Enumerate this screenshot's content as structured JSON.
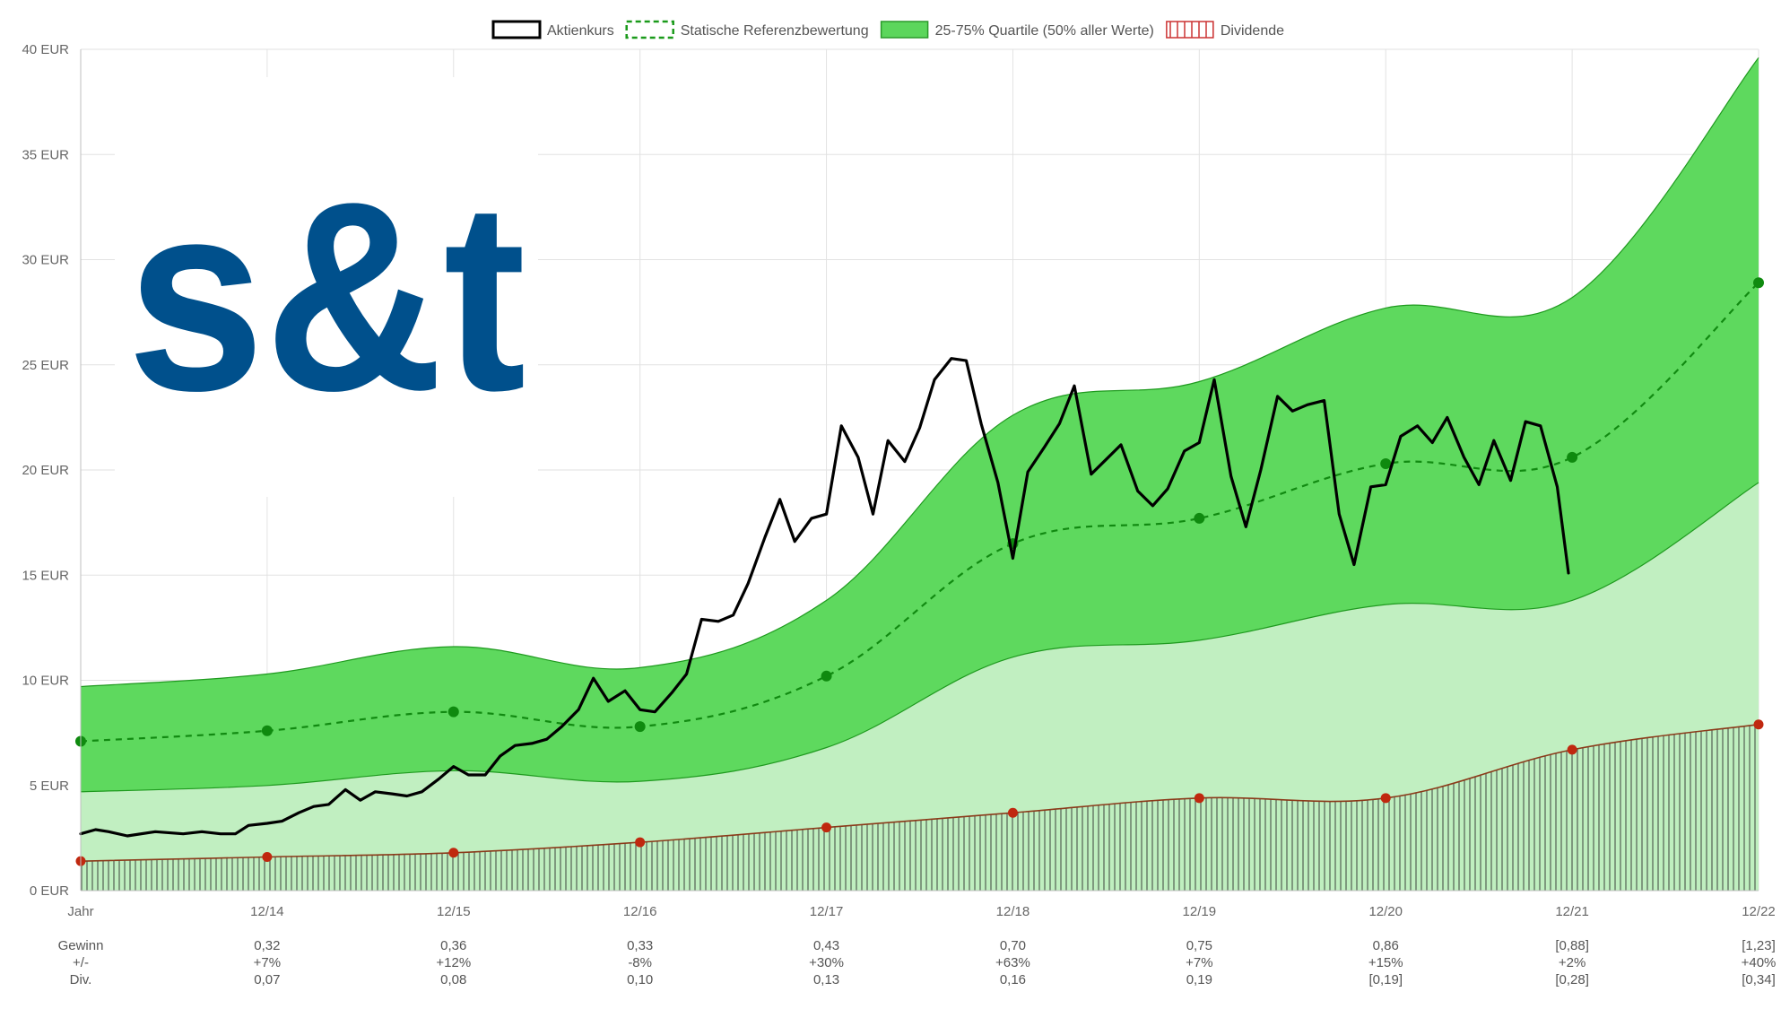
{
  "chart_data": {
    "type": "line",
    "legend": [
      {
        "label": "Aktienkurs",
        "style": "solid",
        "color": "#000000"
      },
      {
        "label": "Statische Referenzbewertung",
        "style": "dashed",
        "color": "#1a9a1a"
      },
      {
        "label": "25-75% Quartile (50% aller Werte)",
        "style": "area",
        "color": "#5cd65c"
      },
      {
        "label": "Dividende",
        "style": "hatched",
        "color": "#cc3333"
      }
    ],
    "legend_position": "top-center",
    "grid": true,
    "x_ticks": [
      "Jahr",
      "12/14",
      "12/15",
      "12/16",
      "12/17",
      "12/18",
      "12/19",
      "12/20",
      "12/21",
      "12/22"
    ],
    "y_ticks": [
      "0 EUR",
      "5 EUR",
      "10 EUR",
      "15 EUR",
      "20 EUR",
      "25 EUR",
      "30 EUR",
      "35 EUR",
      "40 EUR"
    ],
    "ylim": [
      0,
      40
    ],
    "x_index_range": [
      0,
      9
    ],
    "referenzbewertung": [
      7.1,
      7.6,
      8.5,
      7.8,
      10.2,
      16.5,
      17.7,
      20.3,
      20.6,
      28.9
    ],
    "quartile_upper": [
      9.7,
      10.3,
      11.6,
      10.6,
      13.8,
      22.6,
      24.2,
      27.7,
      28.2,
      39.6
    ],
    "quartile_lower": [
      4.7,
      5.0,
      5.7,
      5.2,
      6.8,
      11.1,
      11.9,
      13.6,
      13.8,
      19.4
    ],
    "dividende": [
      1.4,
      1.6,
      1.8,
      2.3,
      3.0,
      3.7,
      4.4,
      4.4,
      6.7,
      7.9
    ],
    "aktienkurs": [
      [
        0.0,
        2.7
      ],
      [
        0.08,
        2.9
      ],
      [
        0.15,
        2.8
      ],
      [
        0.25,
        2.6
      ],
      [
        0.4,
        2.8
      ],
      [
        0.55,
        2.7
      ],
      [
        0.65,
        2.8
      ],
      [
        0.75,
        2.7
      ],
      [
        0.83,
        2.7
      ],
      [
        0.9,
        3.1
      ],
      [
        1.0,
        3.2
      ],
      [
        1.08,
        3.3
      ],
      [
        1.17,
        3.7
      ],
      [
        1.25,
        4.0
      ],
      [
        1.33,
        4.1
      ],
      [
        1.42,
        4.8
      ],
      [
        1.5,
        4.3
      ],
      [
        1.58,
        4.7
      ],
      [
        1.67,
        4.6
      ],
      [
        1.75,
        4.5
      ],
      [
        1.83,
        4.7
      ],
      [
        1.92,
        5.3
      ],
      [
        2.0,
        5.9
      ],
      [
        2.08,
        5.5
      ],
      [
        2.17,
        5.5
      ],
      [
        2.25,
        6.4
      ],
      [
        2.33,
        6.9
      ],
      [
        2.42,
        7.0
      ],
      [
        2.5,
        7.2
      ],
      [
        2.58,
        7.8
      ],
      [
        2.67,
        8.6
      ],
      [
        2.75,
        10.1
      ],
      [
        2.83,
        9.0
      ],
      [
        2.92,
        9.5
      ],
      [
        3.0,
        8.6
      ],
      [
        3.08,
        8.5
      ],
      [
        3.17,
        9.4
      ],
      [
        3.25,
        10.3
      ],
      [
        3.33,
        12.9
      ],
      [
        3.42,
        12.8
      ],
      [
        3.5,
        13.1
      ],
      [
        3.58,
        14.6
      ],
      [
        3.67,
        16.8
      ],
      [
        3.75,
        18.6
      ],
      [
        3.83,
        16.6
      ],
      [
        3.92,
        17.7
      ],
      [
        4.0,
        17.9
      ],
      [
        4.08,
        22.1
      ],
      [
        4.17,
        20.6
      ],
      [
        4.25,
        17.9
      ],
      [
        4.33,
        21.4
      ],
      [
        4.42,
        20.4
      ],
      [
        4.5,
        22.0
      ],
      [
        4.58,
        24.3
      ],
      [
        4.67,
        25.3
      ],
      [
        4.75,
        25.2
      ],
      [
        4.83,
        22.2
      ],
      [
        4.92,
        19.4
      ],
      [
        5.0,
        15.8
      ],
      [
        5.08,
        19.9
      ],
      [
        5.17,
        21.1
      ],
      [
        5.25,
        22.2
      ],
      [
        5.33,
        24.0
      ],
      [
        5.42,
        19.8
      ],
      [
        5.5,
        20.5
      ],
      [
        5.58,
        21.2
      ],
      [
        5.67,
        19.0
      ],
      [
        5.75,
        18.3
      ],
      [
        5.83,
        19.1
      ],
      [
        5.92,
        20.9
      ],
      [
        6.0,
        21.3
      ],
      [
        6.08,
        24.3
      ],
      [
        6.17,
        19.7
      ],
      [
        6.25,
        17.3
      ],
      [
        6.33,
        20.0
      ],
      [
        6.42,
        23.5
      ],
      [
        6.5,
        22.8
      ],
      [
        6.58,
        23.1
      ],
      [
        6.67,
        23.3
      ],
      [
        6.75,
        17.9
      ],
      [
        6.83,
        15.5
      ],
      [
        6.92,
        19.2
      ],
      [
        7.0,
        19.3
      ],
      [
        7.08,
        21.6
      ],
      [
        7.17,
        22.1
      ],
      [
        7.25,
        21.3
      ],
      [
        7.33,
        22.5
      ],
      [
        7.42,
        20.6
      ],
      [
        7.5,
        19.3
      ],
      [
        7.58,
        21.4
      ],
      [
        7.67,
        19.5
      ],
      [
        7.75,
        22.3
      ],
      [
        7.83,
        22.1
      ],
      [
        7.92,
        19.2
      ],
      [
        7.98,
        15.1
      ]
    ]
  },
  "logo": {
    "text": "s&t",
    "color": "#00508c"
  },
  "table": {
    "row_labels": [
      "Gewinn",
      "+/-",
      "Div."
    ],
    "columns": [
      {
        "gewinn": "0,32",
        "change": "+7%",
        "div": "0,07"
      },
      {
        "gewinn": "0,36",
        "change": "+12%",
        "div": "0,08"
      },
      {
        "gewinn": "0,33",
        "change": "-8%",
        "div": "0,10"
      },
      {
        "gewinn": "0,43",
        "change": "+30%",
        "div": "0,13"
      },
      {
        "gewinn": "0,70",
        "change": "+63%",
        "div": "0,16"
      },
      {
        "gewinn": "0,75",
        "change": "+7%",
        "div": "0,19"
      },
      {
        "gewinn": "0,86",
        "change": "+15%",
        "div": "[0,19]"
      },
      {
        "gewinn": "[0,88]",
        "change": "+2%",
        "div": "[0,28]"
      },
      {
        "gewinn": "[1,23]",
        "change": "+40%",
        "div": "[0,34]"
      }
    ]
  }
}
